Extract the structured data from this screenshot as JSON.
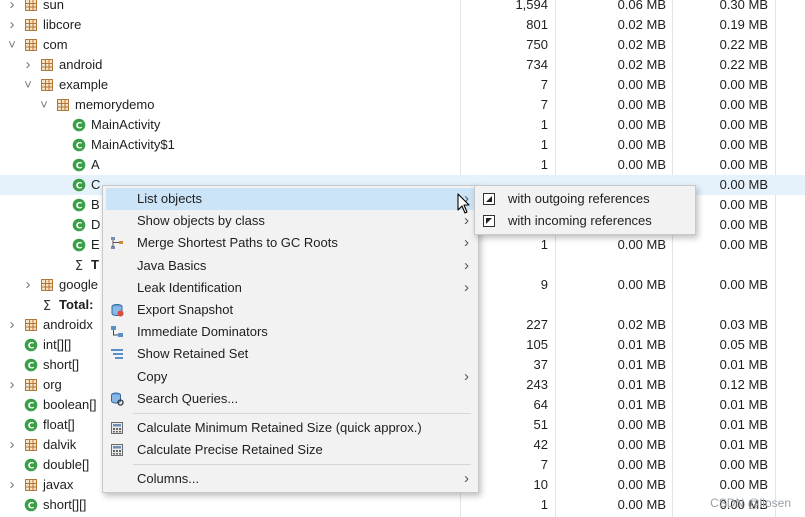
{
  "tree": {
    "rows": [
      {
        "label": "sun",
        "c1": "1,594",
        "c2": "0.06 MB",
        "c3": "0.30 MB",
        "kind": "package",
        "arrow": "right",
        "indent": 0
      },
      {
        "label": "libcore",
        "c1": "801",
        "c2": "0.02 MB",
        "c3": "0.19 MB",
        "kind": "package",
        "arrow": "right",
        "indent": 0
      },
      {
        "label": "com",
        "c1": "750",
        "c2": "0.02 MB",
        "c3": "0.22 MB",
        "kind": "package",
        "arrow": "down",
        "indent": 0
      },
      {
        "label": "android",
        "c1": "734",
        "c2": "0.02 MB",
        "c3": "0.22 MB",
        "kind": "package",
        "arrow": "right",
        "indent": 1
      },
      {
        "label": "example",
        "c1": "7",
        "c2": "0.00 MB",
        "c3": "0.00 MB",
        "kind": "package",
        "arrow": "down",
        "indent": 1
      },
      {
        "label": "memorydemo",
        "c1": "7",
        "c2": "0.00 MB",
        "c3": "0.00 MB",
        "kind": "package",
        "arrow": "down",
        "indent": 2
      },
      {
        "label": "MainActivity",
        "c1": "1",
        "c2": "0.00 MB",
        "c3": "0.00 MB",
        "kind": "class",
        "arrow": "",
        "indent": 3
      },
      {
        "label": "MainActivity$1",
        "c1": "1",
        "c2": "0.00 MB",
        "c3": "0.00 MB",
        "kind": "class",
        "arrow": "",
        "indent": 3
      },
      {
        "label": "A",
        "c1": "1",
        "c2": "0.00 MB",
        "c3": "0.00 MB",
        "kind": "class",
        "arrow": "",
        "indent": 3
      },
      {
        "label": "C",
        "c1": "",
        "c2": "",
        "c3": "0.00 MB",
        "kind": "class",
        "arrow": "",
        "indent": 3,
        "selected": true
      },
      {
        "label": "B",
        "c1": "",
        "c2": "",
        "c3": "0.00 MB",
        "kind": "class",
        "arrow": "",
        "indent": 3
      },
      {
        "label": "D",
        "c1": "",
        "c2": "",
        "c3": "0.00 MB",
        "kind": "class",
        "arrow": "",
        "indent": 3
      },
      {
        "label": "E",
        "c1": "1",
        "c2": "0.00 MB",
        "c3": "0.00 MB",
        "kind": "class",
        "arrow": "",
        "indent": 3
      },
      {
        "label": "T",
        "c1": "",
        "c2": "",
        "c3": "",
        "kind": "sum",
        "arrow": "",
        "indent": 3,
        "bold": true
      },
      {
        "label": "google",
        "c1": "9",
        "c2": "0.00 MB",
        "c3": "0.00 MB",
        "kind": "package",
        "arrow": "right",
        "indent": 1
      },
      {
        "label": "Total: ",
        "c1": "",
        "c2": "",
        "c3": "",
        "kind": "sum",
        "arrow": "",
        "indent": 1,
        "bold": true
      },
      {
        "label": "androidx",
        "c1": "227",
        "c2": "0.02 MB",
        "c3": "0.03 MB",
        "kind": "package",
        "arrow": "right",
        "indent": 0
      },
      {
        "label": "int[][]",
        "c1": "105",
        "c2": "0.01 MB",
        "c3": "0.05 MB",
        "kind": "class",
        "arrow": "",
        "indent": 0
      },
      {
        "label": "short[]",
        "c1": "37",
        "c2": "0.01 MB",
        "c3": "0.01 MB",
        "kind": "class",
        "arrow": "",
        "indent": 0
      },
      {
        "label": "org",
        "c1": "243",
        "c2": "0.01 MB",
        "c3": "0.12 MB",
        "kind": "package",
        "arrow": "right",
        "indent": 0
      },
      {
        "label": "boolean[]",
        "c1": "64",
        "c2": "0.01 MB",
        "c3": "0.01 MB",
        "kind": "class",
        "arrow": "",
        "indent": 0
      },
      {
        "label": "float[]",
        "c1": "51",
        "c2": "0.00 MB",
        "c3": "0.01 MB",
        "kind": "class",
        "arrow": "",
        "indent": 0
      },
      {
        "label": "dalvik",
        "c1": "42",
        "c2": "0.00 MB",
        "c3": "0.01 MB",
        "kind": "package",
        "arrow": "right",
        "indent": 0
      },
      {
        "label": "double[]",
        "c1": "7",
        "c2": "0.00 MB",
        "c3": "0.00 MB",
        "kind": "class",
        "arrow": "",
        "indent": 0
      },
      {
        "label": "javax",
        "c1": "10",
        "c2": "0.00 MB",
        "c3": "0.00 MB",
        "kind": "package",
        "arrow": "right",
        "indent": 0
      },
      {
        "label": "short[][]",
        "c1": "1",
        "c2": "0.00 MB",
        "c3": "0.00 MB",
        "kind": "class",
        "arrow": "",
        "indent": 0
      }
    ]
  },
  "context_menu": {
    "items": [
      {
        "label": "List objects",
        "submenu": true,
        "hover": true,
        "icon": ""
      },
      {
        "label": "Show objects by class",
        "submenu": true,
        "icon": ""
      },
      {
        "label": "Merge Shortest Paths to GC Roots",
        "submenu": true,
        "icon": "merge-paths-icon"
      },
      {
        "label": "Java Basics",
        "submenu": true,
        "icon": ""
      },
      {
        "label": "Leak Identification",
        "submenu": true,
        "icon": ""
      },
      {
        "label": "Export Snapshot",
        "submenu": false,
        "icon": "export-snapshot-icon"
      },
      {
        "label": "Immediate Dominators",
        "submenu": false,
        "icon": "immediate-dominators-icon"
      },
      {
        "label": "Show Retained Set",
        "submenu": false,
        "icon": "retained-set-icon"
      },
      {
        "label": "Copy",
        "submenu": true,
        "icon": ""
      },
      {
        "label": "Search Queries...",
        "submenu": false,
        "icon": "search-queries-icon"
      },
      {
        "separator": true
      },
      {
        "label": "Calculate Minimum Retained Size (quick approx.)",
        "submenu": false,
        "icon": "calculator-icon"
      },
      {
        "label": "Calculate Precise Retained Size",
        "submenu": false,
        "icon": "calculator-icon"
      },
      {
        "separator": true
      },
      {
        "label": "Columns...",
        "submenu": true,
        "icon": ""
      }
    ]
  },
  "submenu": {
    "items": [
      {
        "label": "with outgoing references",
        "icon": "outgoing-references-icon"
      },
      {
        "label": "with incoming references",
        "icon": "incoming-references-icon"
      }
    ]
  },
  "watermark": "CSDN @llosen",
  "colors": {
    "selection": "#e5f1fb",
    "menu_hover": "#cce4f7",
    "class_icon": "#3a9e47",
    "package_icon": "#b0763a"
  }
}
